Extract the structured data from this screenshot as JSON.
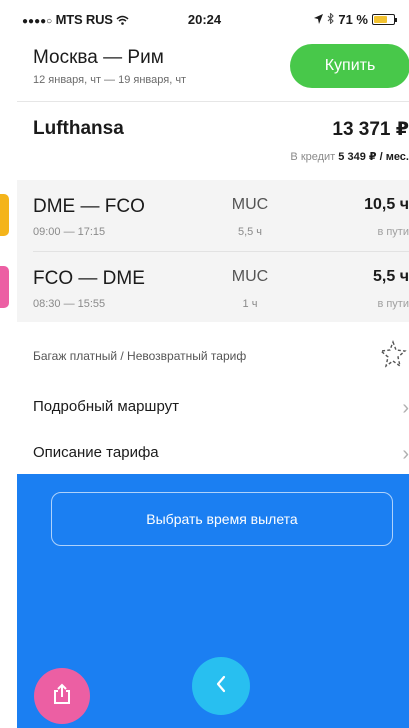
{
  "status_bar": {
    "carrier": "MTS RUS",
    "signal_dots": "●●●●○",
    "time": "20:24",
    "battery": "71 %",
    "battery_level": 0.71,
    "battery_color": "#f2c230",
    "icons": [
      "wifi-icon",
      "location-arrow-icon",
      "bluetooth-icon",
      "battery-icon"
    ]
  },
  "header": {
    "route_title": "Москва — Рим",
    "dates": "12 января, чт — 19 января, чт",
    "buy_label": "Купить",
    "buy_color": "#48c84a"
  },
  "offer": {
    "airline": "Lufthansa",
    "price": "13 371 ₽",
    "credit_prefix": "В кредит",
    "credit_amount": "5 349 ₽ / мес."
  },
  "legs": [
    {
      "route": "DME — FCO",
      "times": "09:00 — 17:15",
      "stop": "MUC",
      "stop_duration": "5,5 ч",
      "duration": "10,5 ч",
      "duration_label": "в пути",
      "accent_color": "#f4b41a"
    },
    {
      "route": "FCO — DME",
      "times": "08:30 — 15:55",
      "stop": "MUC",
      "stop_duration": "1 ч",
      "duration": "5,5 ч",
      "duration_label": "в пути",
      "accent_color": "#ec5fa3"
    }
  ],
  "baggage": {
    "text": "Багаж платный / Невозвратный тариф",
    "icon": "star-outline-icon"
  },
  "menu": {
    "route_details": "Подробный маршрут",
    "tariff_description": "Описание тарифа",
    "chevron": "›"
  },
  "bottom": {
    "select_time_label": "Выбрать время вылета",
    "panel_color": "#1b7ff2",
    "share_icon": "share-icon",
    "back_icon": "chevron-left-icon"
  }
}
